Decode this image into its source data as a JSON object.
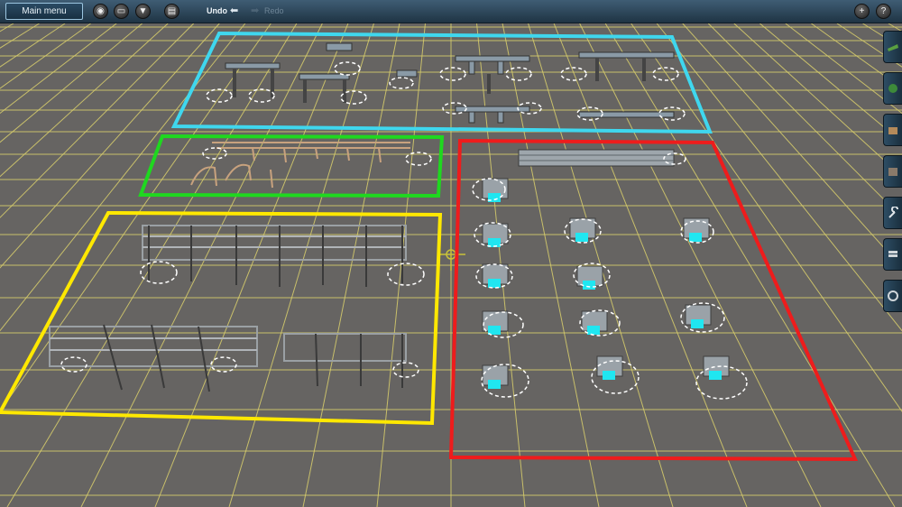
{
  "toolbar": {
    "main_menu_label": "Main menu",
    "undo_label": "Undo",
    "redo_label": "Redo"
  },
  "icons": {
    "left": [
      "camera-icon",
      "trash-icon",
      "filter-icon",
      "delete-icon"
    ],
    "right": [
      "add-icon",
      "help-icon"
    ],
    "sidebar": [
      "track-tool-icon",
      "scenery-tool-icon",
      "building-tool-icon",
      "layers-tool-icon",
      "wrench-tool-icon",
      "stack-tool-icon",
      "settings-tool-icon"
    ]
  },
  "colors": {
    "selection_cyan": "#3fd7ee",
    "selection_green": "#1fd81f",
    "selection_yellow": "#ffe800",
    "selection_red": "#ee1c1c",
    "grid_line": "#e0d66f",
    "ground": "#666462"
  }
}
